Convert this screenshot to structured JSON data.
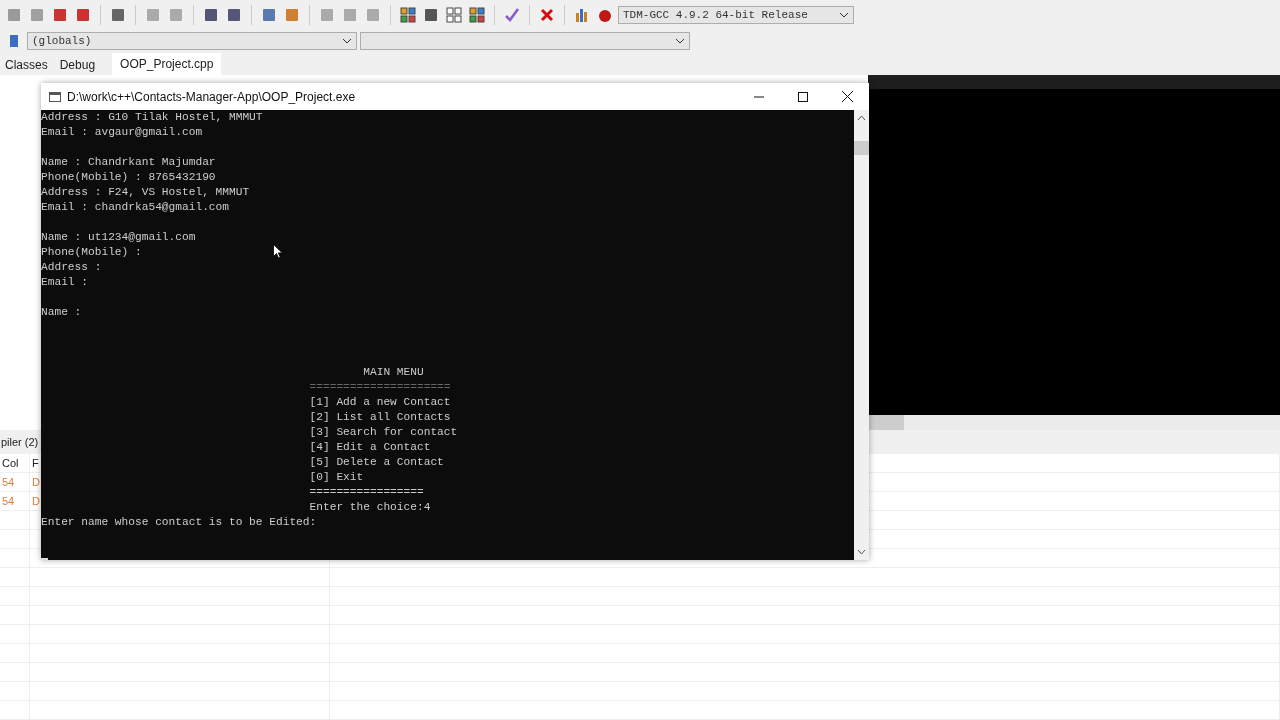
{
  "toolbar": {
    "compiler": "TDM-GCC 4.9.2 64-bit Release"
  },
  "toolbar2": {
    "scope": "(globals)"
  },
  "side_tabs": [
    {
      "label": "Classes",
      "selected": false
    },
    {
      "label": "Debug",
      "selected": false
    }
  ],
  "editor_tabs": [
    {
      "label": "OOP_Project.cpp",
      "selected": true
    }
  ],
  "messages": {
    "tab": "piler (2)",
    "columns": [
      "Col",
      "F"
    ],
    "rows": [
      [
        "54",
        "D"
      ],
      [
        "54",
        "D"
      ]
    ]
  },
  "console": {
    "title": "D:\\work\\c++\\Contacts-Manager-App\\OOP_Project.exe",
    "records": [
      {
        "lines": [
          "Address : G10 Tilak Hostel, MMMUT",
          "Email : avgaur@gmail.com"
        ]
      },
      {
        "lines": [
          "Name : Chandrkant Majumdar",
          "Phone(Mobile) : 8765432190",
          "Address : F24, VS Hostel, MMMUT",
          "Email : chandrka54@gmail.com"
        ]
      },
      {
        "lines": [
          "Name : ut1234@gmail.com",
          "Phone(Mobile) :",
          "Address :",
          "Email :"
        ]
      },
      {
        "lines": [
          "Name :"
        ]
      }
    ],
    "menu": {
      "title": "MAIN MENU",
      "rule_top": "=====================",
      "items": [
        "[1] Add a new Contact",
        "[2] List all Contacts",
        "[3] Search for contact",
        "[4] Edit a Contact",
        "[5] Delete a Contact",
        "[0] Exit"
      ],
      "rule_bottom": "=================",
      "prompt": "Enter the choice:4"
    },
    "last_line": "Enter name whose contact is to be Edited:"
  }
}
